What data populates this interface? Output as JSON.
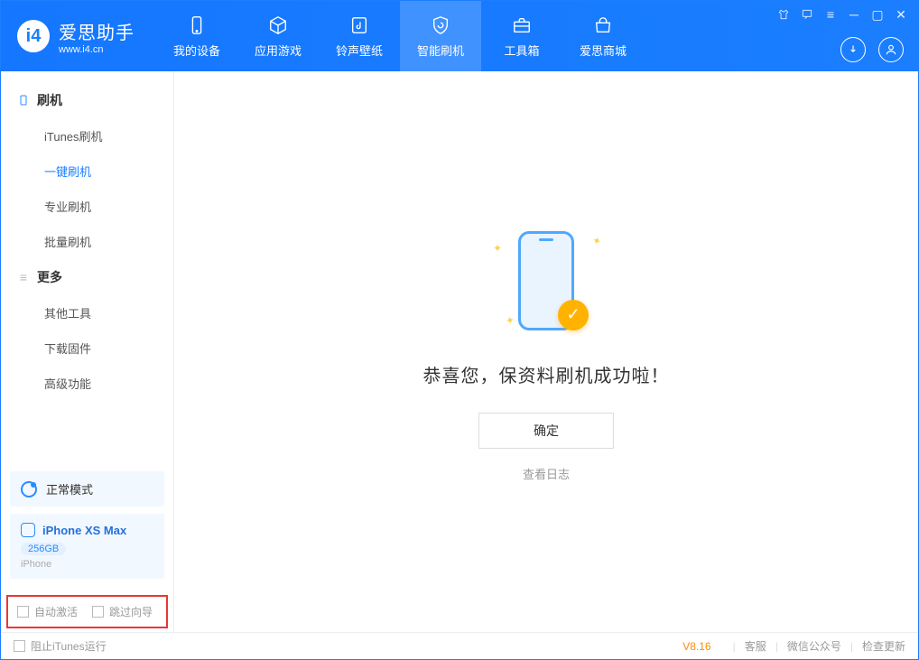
{
  "header": {
    "app_name": "爱思助手",
    "app_url": "www.i4.cn",
    "tabs": [
      {
        "label": "我的设备"
      },
      {
        "label": "应用游戏"
      },
      {
        "label": "铃声壁纸"
      },
      {
        "label": "智能刷机"
      },
      {
        "label": "工具箱"
      },
      {
        "label": "爱思商城"
      }
    ]
  },
  "sidebar": {
    "group1_title": "刷机",
    "group1_items": [
      "iTunes刷机",
      "一键刷机",
      "专业刷机",
      "批量刷机"
    ],
    "group2_title": "更多",
    "group2_items": [
      "其他工具",
      "下载固件",
      "高级功能"
    ],
    "mode_label": "正常模式",
    "device_name": "iPhone XS Max",
    "device_capacity": "256GB",
    "device_type": "iPhone"
  },
  "options": {
    "auto_activate": "自动激活",
    "skip_guide": "跳过向导"
  },
  "main": {
    "success_text": "恭喜您，保资料刷机成功啦！",
    "ok_button": "确定",
    "view_log": "查看日志"
  },
  "footer": {
    "block_itunes": "阻止iTunes运行",
    "version": "V8.16",
    "links": [
      "客服",
      "微信公众号",
      "检查更新"
    ]
  }
}
